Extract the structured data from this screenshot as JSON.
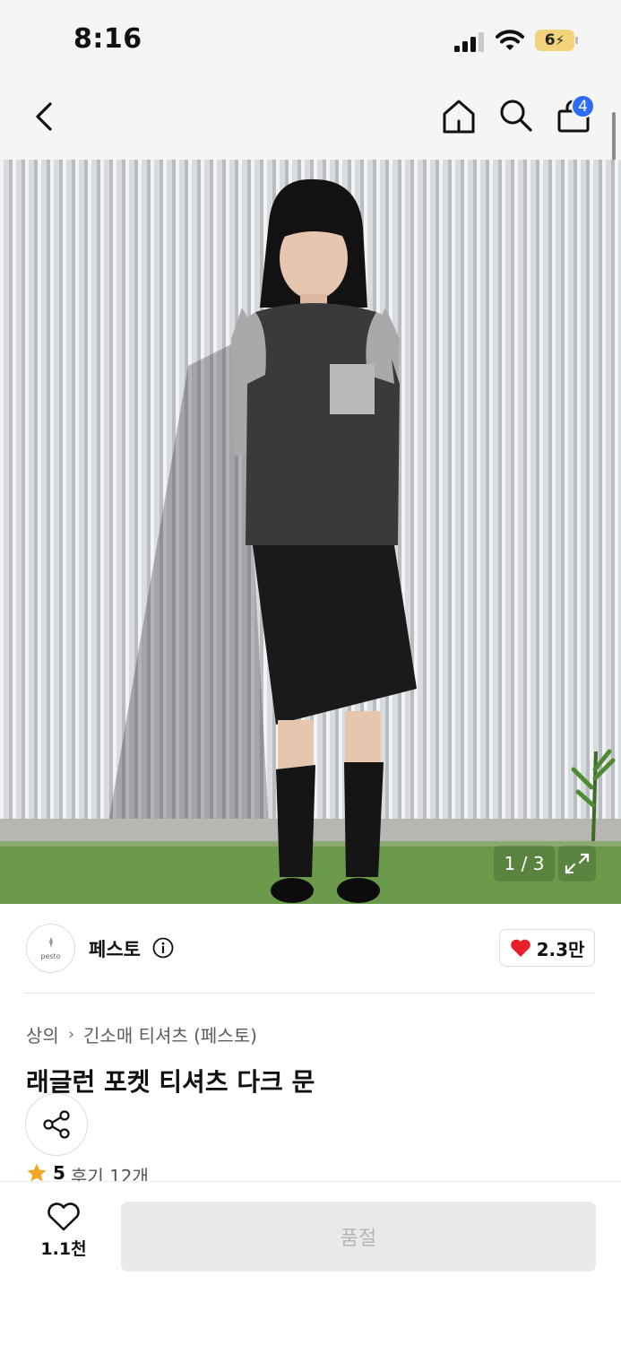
{
  "status_bar": {
    "time": "8:16",
    "battery": "6"
  },
  "nav": {
    "cart_count": "4"
  },
  "gallery": {
    "counter": "1 / 3",
    "current": 1,
    "total": 3
  },
  "brand": {
    "name": "페스토",
    "logo_text": "pesto",
    "likes": "2.3만"
  },
  "breadcrumb": {
    "category": "상의",
    "subcategory": "긴소매 티셔츠 (페스토)"
  },
  "product": {
    "title": "래글런 포켓 티셔츠 다크 문",
    "rating": "5",
    "reviews": "후기 12개"
  },
  "bottom": {
    "wish_count": "1.1천",
    "soldout_label": "품절"
  },
  "colors": {
    "accent": "#2d6cf6",
    "heart": "#e8202a",
    "star": "#f5a623"
  }
}
